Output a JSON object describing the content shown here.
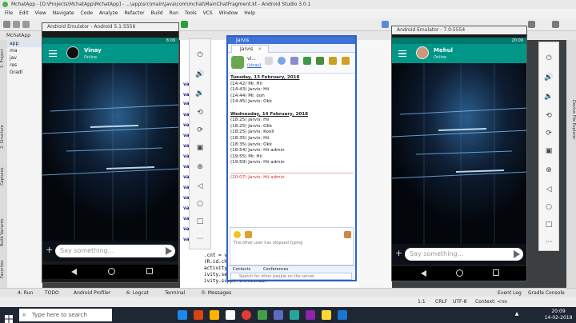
{
  "ide": {
    "title": "MchatApp - [D:\\Projects\\MchatApp\\MchatApp] - ...\\app\\src\\main\\java\\com\\mchat\\MainChatFragment.kt - Android Studio 3.0.1",
    "menu": [
      "File",
      "Edit",
      "View",
      "Navigate",
      "Code",
      "Analyze",
      "Refactor",
      "Build",
      "Run",
      "Tools",
      "VCS",
      "Window",
      "Help"
    ],
    "nav_path": "MchatApp",
    "project_tree": [
      "app",
      "ma",
      "jav",
      "res",
      "Gradl"
    ],
    "left_tabs": [
      "1: Project",
      "2: Structure",
      "Captures",
      "Build Variants",
      "Favorites"
    ],
    "right_tabs": [
      "Device File Explorer"
    ],
    "bottom_tabs": [
      "4: Run",
      "TODO",
      "Android Profiler",
      "6: Logcat",
      "Terminal",
      "0: Messages"
    ],
    "bottom_right": [
      "Event Log",
      "Gradle Console"
    ],
    "status_bar": [
      "1:1",
      "CRLF",
      "UTF-8",
      "Context: <no context>"
    ],
    "code_lines": [
      "var",
      "var",
      "var",
      "var",
      "var",
      "var",
      "var",
      "var",
      "var",
      "var",
      "var",
      "var",
      "var",
      "var",
      "var",
      "var",
      ".cnt = view.findViewById",
      "(R.id.chatGroup)",
      "activity = activity as AppCompatActivity",
      "ivity.setSupportActionBar",
      "ivity.supportActionBar"
    ]
  },
  "emulator_left": {
    "title": "Android Emulator - Android 5.1:5556",
    "time": "8:09",
    "contact_name": "Vinay",
    "contact_status": "Online",
    "input_placeholder": "Say something..."
  },
  "emulator_right": {
    "title": "Android Emulator - 7.0:5554",
    "time": "20:09",
    "contact_name": "Mehul",
    "contact_status": "Online",
    "input_placeholder": "Say something..."
  },
  "jarvis": {
    "title": "Jarvis",
    "tab_label": "Jarvis",
    "user_short": "vi...",
    "user_status": "(vinay)",
    "chat_lines": [
      {
        "text": "Tuesday, 13 February, 2018",
        "kind": "hdr"
      },
      {
        "text": "(14:42) Mr. Hii",
        "kind": ""
      },
      {
        "text": "(14:43) Jarvis: Hii",
        "kind": ""
      },
      {
        "text": "(14:44) Mr. ooh",
        "kind": ""
      },
      {
        "text": "(14:45) Jarvis: Okk",
        "kind": ""
      },
      {
        "text": "",
        "kind": ""
      },
      {
        "text": "Wednesday, 14 February, 2018",
        "kind": "hdr"
      },
      {
        "text": "(18:25) Jarvis: Hii",
        "kind": ""
      },
      {
        "text": "(18:25) Jarvis: Okk",
        "kind": ""
      },
      {
        "text": "(18:25) Jarvis: Kooll",
        "kind": ""
      },
      {
        "text": "(18:35) Jarvis: Hii",
        "kind": ""
      },
      {
        "text": "(18:35) Jarvis: Okk",
        "kind": ""
      },
      {
        "text": "(18:54) Jarvis: Hii admin",
        "kind": ""
      },
      {
        "text": "(19:55) Mr. Hii",
        "kind": ""
      },
      {
        "text": "(19:59) Jarvis: Hii admin",
        "kind": ""
      },
      {
        "text": "",
        "kind": ""
      },
      {
        "text": "(20:07) Jarvis: Hii admin",
        "kind": "red"
      }
    ],
    "typing_status": "The other user has stopped typing",
    "footer_tabs": [
      "Contacts",
      "Conferences"
    ],
    "search_placeholder": "Search for other people on the server"
  },
  "taskbar": {
    "search_placeholder": "Type here to search",
    "clock_time": "20:09",
    "clock_date": "14-02-2018"
  },
  "colors": {
    "appbar": "#009688",
    "jarvis_border": "#2f62c9",
    "taskbar": "#1f2734"
  }
}
